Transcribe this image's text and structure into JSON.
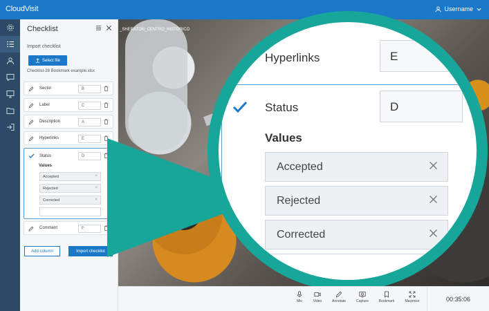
{
  "app": {
    "logo_text": "CloudVisit",
    "username": "Username"
  },
  "rail": {
    "icons": [
      "settings-icon",
      "checklist-icon",
      "user-icon",
      "chat-icon",
      "screen-icon",
      "folder-icon",
      "exit-icon"
    ]
  },
  "panel": {
    "title": "Checklist",
    "import_title": "Import checklist",
    "select_file": "Select file",
    "filename": "Checklist-28 Bookmark example.xlsx",
    "rows": [
      {
        "label": "Sector",
        "value": "B"
      },
      {
        "label": "Label",
        "value": "C"
      },
      {
        "label": "Description",
        "value": "A"
      },
      {
        "label": "Hyperlinks",
        "value": "E"
      }
    ],
    "status": {
      "label": "Status",
      "value": "D",
      "values_title": "Values",
      "chips": [
        "Accepted",
        "Rejected",
        "Corrected"
      ]
    },
    "comment": {
      "label": "Comment",
      "value": "F"
    },
    "add_column": "Add column",
    "import_checklist": "Import checklist"
  },
  "photo": {
    "caption": "_SHERATON_CENTRO_HISTORICO"
  },
  "zoom": {
    "hyperlinks_label": "Hyperlinks",
    "hyperlinks_value": "E",
    "status_label": "Status",
    "status_value": "D",
    "values_title": "Values",
    "chips": [
      "Accepted",
      "Rejected",
      "Corrected"
    ]
  },
  "toolbar": {
    "tools": [
      "Mic",
      "Video",
      "Annotate",
      "Capture",
      "Bookmark",
      "Maximize"
    ],
    "timer": "00:35:06"
  },
  "colors": {
    "primary": "#1b78c8",
    "rail": "#2c4a66",
    "teal": "#17a69a"
  }
}
